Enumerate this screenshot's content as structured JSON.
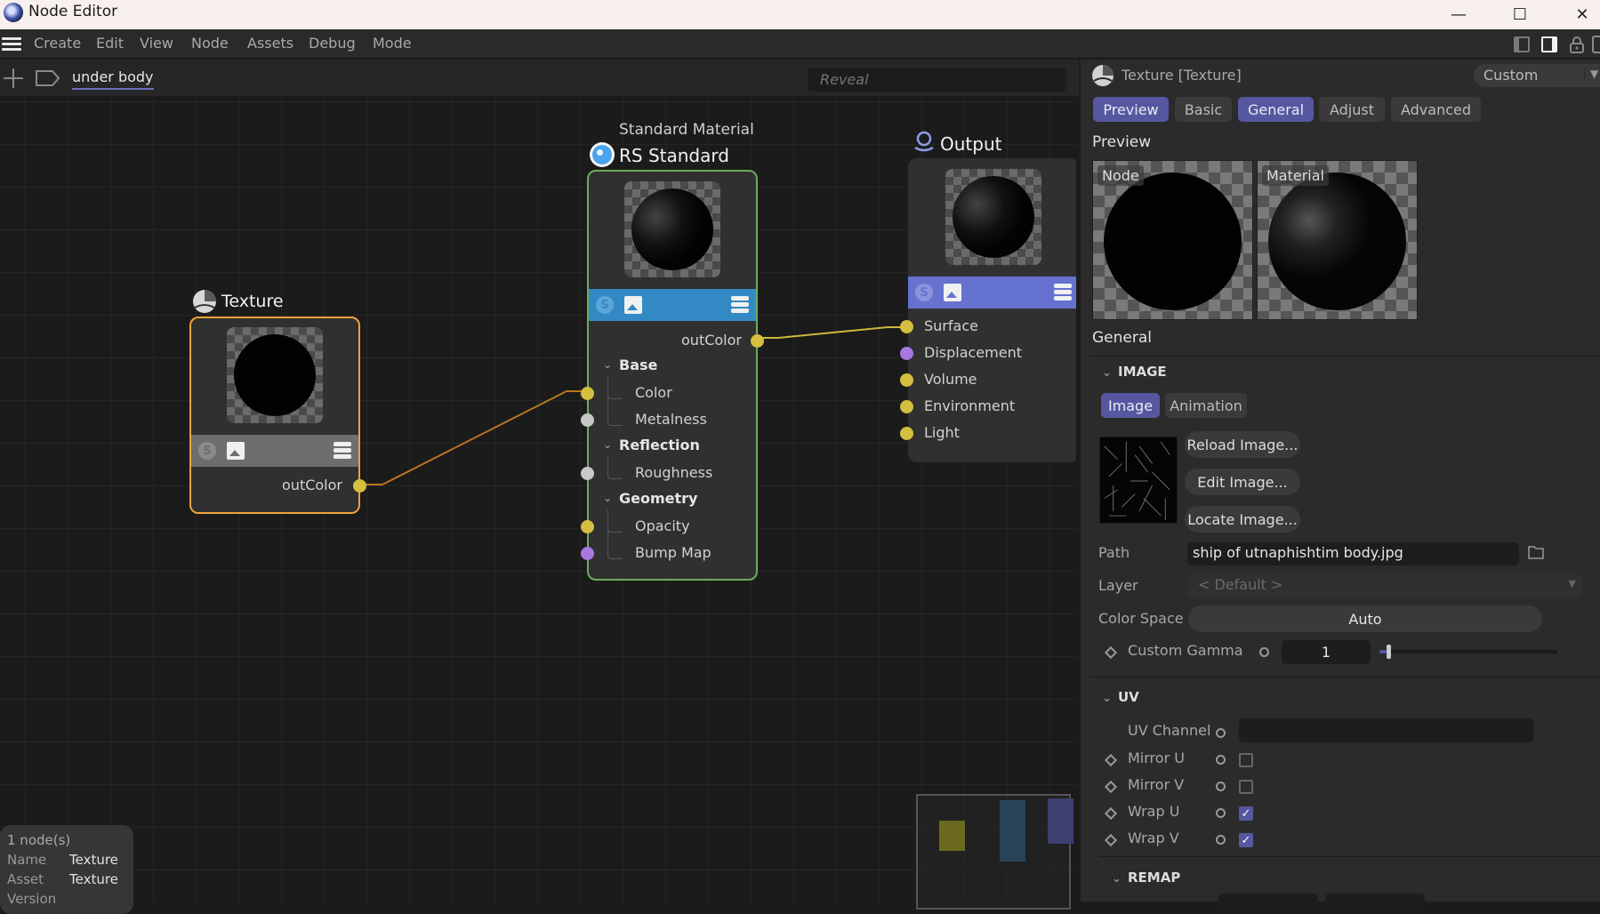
{
  "window": {
    "title": "Node Editor",
    "controls": {
      "minimize": "—",
      "maximize": "☐",
      "close": "✕"
    }
  },
  "menubar": {
    "items": [
      "Create",
      "Edit",
      "View",
      "Node",
      "Assets",
      "Debug",
      "Mode"
    ],
    "right_icons": [
      "layout-left-icon",
      "layout-right-icon",
      "lock-icon",
      "new-window-icon"
    ]
  },
  "toolbar": {
    "breadcrumb": "under body",
    "search_placeholder": "Reveal"
  },
  "nodes": {
    "texture": {
      "title": "Texture",
      "output": "outColor",
      "bar_color": "#6e6e6e",
      "border_color": "#f0a23c"
    },
    "rs_standard": {
      "subtitle": "Standard Material",
      "title": "RS Standard",
      "output": "outColor",
      "bar_color": "#3389c4",
      "border_color": "#6aad5c",
      "groups": [
        {
          "label": "Base",
          "ports": [
            "Color",
            "Metalness"
          ]
        },
        {
          "label": "Reflection",
          "ports": [
            "Roughness"
          ]
        },
        {
          "label": "Geometry",
          "ports": [
            "Opacity",
            "Bump Map"
          ]
        }
      ]
    },
    "output": {
      "title": "Output",
      "bar_color": "#6672cf",
      "inputs": [
        "Surface",
        "Displacement",
        "Volume",
        "Environment",
        "Light"
      ]
    }
  },
  "port_colors": {
    "yellow": "#d4bf3e",
    "gray": "#c8c8c8",
    "purple": "#a877e0"
  },
  "connections": [
    {
      "from": "Texture.outColor",
      "to": "RS Standard.Color",
      "color": "#b8761e"
    },
    {
      "from": "RS Standard.outColor",
      "to": "Output.Surface",
      "color": "#cdb83a"
    }
  ],
  "info_box": {
    "count": "1 node(s)",
    "rows": [
      {
        "key": "Name",
        "value": "Texture"
      },
      {
        "key": "Asset",
        "value": "Texture"
      },
      {
        "key": "Version",
        "value": ""
      }
    ]
  },
  "panel": {
    "header": "Texture [Texture]",
    "preset": "Custom",
    "tabs": [
      {
        "label": "Preview",
        "active": true
      },
      {
        "label": "Basic",
        "active": false
      },
      {
        "label": "General",
        "active": true
      },
      {
        "label": "Adjust",
        "active": false
      },
      {
        "label": "Advanced",
        "active": false
      }
    ],
    "preview_title": "Preview",
    "preview_labels": [
      "Node",
      "Material"
    ],
    "general_title": "General",
    "image_section": {
      "title": "IMAGE",
      "subtabs": [
        {
          "label": "Image",
          "active": true
        },
        {
          "label": "Animation",
          "active": false
        }
      ],
      "buttons": [
        "Reload Image...",
        "Edit Image...",
        "Locate Image..."
      ],
      "path_label": "Path",
      "path_value": "ship of utnaphishtim body.jpg",
      "layer_label": "Layer",
      "layer_value": "< Default >",
      "colorspace_label": "Color Space",
      "colorspace_value": "Auto",
      "gamma_label": "Custom Gamma",
      "gamma_value": "1",
      "gamma_slider_fraction": 0.02
    },
    "uv_section": {
      "title": "UV",
      "uv_channel_label": "UV Channel",
      "uv_channel_value": "",
      "checks": [
        {
          "label": "Mirror U",
          "checked": false
        },
        {
          "label": "Mirror V",
          "checked": false
        },
        {
          "label": "Wrap U",
          "checked": true
        },
        {
          "label": "Wrap V",
          "checked": true
        }
      ]
    },
    "remap_section": {
      "title": "REMAP"
    },
    "accent_color": "#5558a0"
  }
}
